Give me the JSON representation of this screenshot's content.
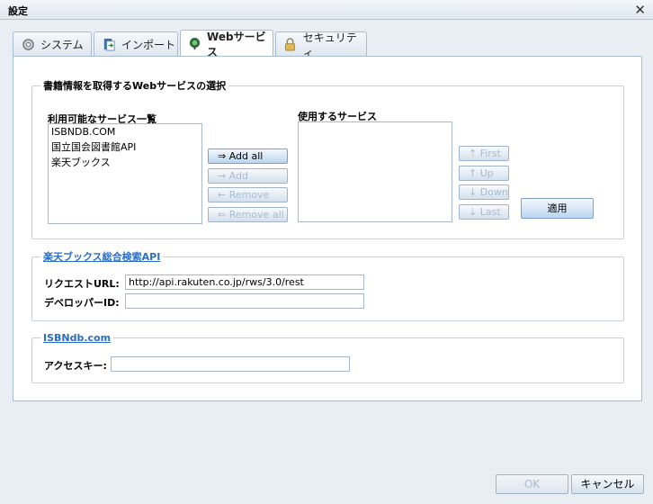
{
  "window": {
    "title": "設定"
  },
  "tabs": [
    {
      "label": "システム",
      "icon": "gear-icon"
    },
    {
      "label": "インポート",
      "icon": "import-icon"
    },
    {
      "label": "Webサービス",
      "icon": "web-service-icon",
      "active": true
    },
    {
      "label": "セキュリティ",
      "icon": "lock-icon"
    }
  ],
  "services_section": {
    "legend": "書籍情報を取得するWebサービスの選択",
    "available_label": "利用可能なサービス一覧",
    "available_items": [
      "ISBNDB.COM",
      "国立国会図書館API",
      "楽天ブックス"
    ],
    "selected_label": "使用するサービス",
    "selected_items": [],
    "buttons": {
      "add_all": "⇒ Add all",
      "add": "→ Add",
      "remove": "← Remove",
      "remove_all": "⇐ Remove all",
      "first": "⇡ First",
      "up": "↑ Up",
      "down": "↓ Down",
      "last": "⇣ Last",
      "apply": "適用"
    }
  },
  "rakuten_section": {
    "legend": "楽天ブックス総合検索API",
    "request_url_label": "リクエストURL:",
    "request_url_value": "http://api.rakuten.co.jp/rws/3.0/rest",
    "developer_id_label": "デベロッパーID:",
    "developer_id_value": ""
  },
  "isbndb_section": {
    "legend": "ISBNdb.com",
    "access_key_label": "アクセスキー:",
    "access_key_value": ""
  },
  "footer": {
    "ok": "OK",
    "cancel": "キャンセル"
  }
}
